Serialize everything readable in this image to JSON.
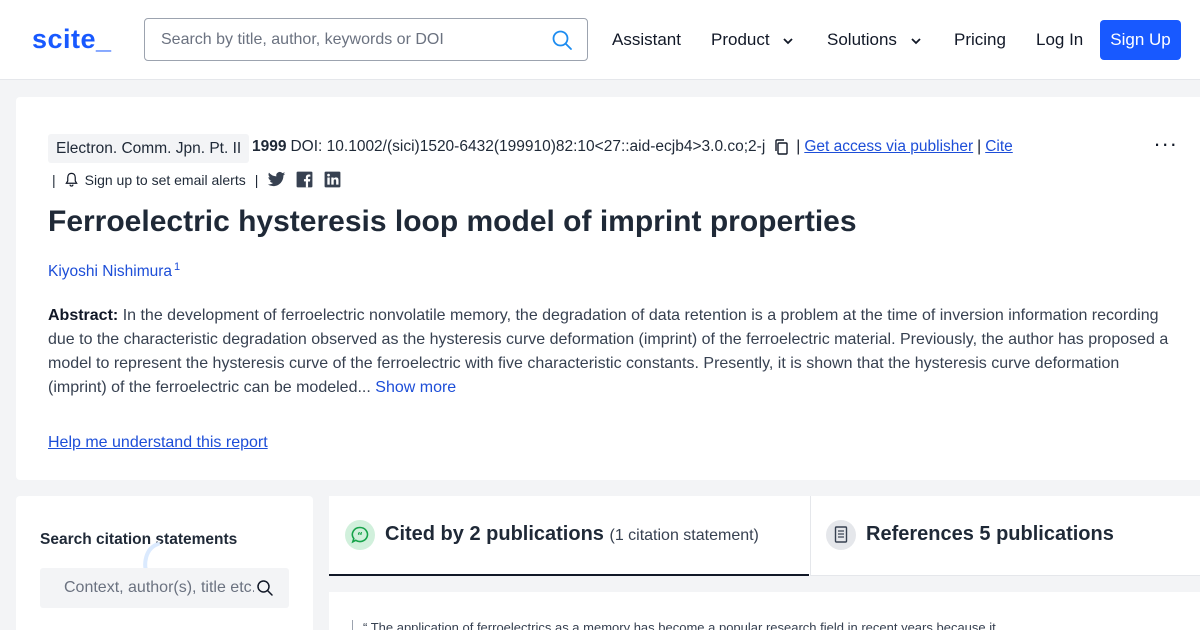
{
  "header": {
    "logo": "scite_",
    "search_placeholder": "Search by title, author, keywords or DOI",
    "nav": {
      "assistant": "Assistant",
      "product": "Product",
      "solutions": "Solutions",
      "pricing": "Pricing",
      "login": "Log In",
      "signup": "Sign Up"
    }
  },
  "paper": {
    "journal": "Electron. Comm. Jpn. Pt. II",
    "year": "1999",
    "doi": "DOI: 10.1002/(sici)1520-6432(199910)82:10<27::aid-ecjb4>3.0.co;2-j",
    "separator": "|",
    "get_access": "Get access via publisher",
    "cite": "Cite",
    "email_alerts": "Sign up to set email alerts",
    "more_menu": "...",
    "title": "Ferroelectric hysteresis loop model of imprint properties",
    "author": "Kiyoshi Nishimura",
    "author_affiliation_mark": "1",
    "abstract_label": "Abstract:",
    "abstract_text": "In the development of ferroelectric nonvolatile memory, the degradation of data retention is a problem at the time of inversion information recording due to the characteristic degradation observed as the hysteresis curve deformation (imprint) of the ferroelectric material. Previously, the author has proposed a model to represent the hysteresis curve of the ferroelectric with five characteristic constants. Presently, it is shown that the hysteresis curve deformation (imprint) of the ferroelectric can be modeled...",
    "show_more": "Show more",
    "help_link": "Help me understand this report"
  },
  "sidebar": {
    "title": "Search citation statements",
    "search_placeholder": "Context, author(s), title etc."
  },
  "tabs": {
    "cited_label": "Cited by 2 publications",
    "cited_sub": "(1 citation statement)",
    "refs_label": "References 5 publications"
  },
  "statement": {
    "quote": "“ The application of ferroelectrics as a memory has become a popular research field in recent years because it"
  },
  "colors": {
    "brand": "#1859ff",
    "link": "#1d4ed8",
    "background": "#f3f4f6"
  },
  "icons": [
    "search-icon",
    "chevron-down-icon",
    "copy-icon",
    "bell-icon",
    "twitter-icon",
    "facebook-icon",
    "linkedin-icon",
    "more-icon",
    "quote-bubble-icon",
    "document-icon"
  ]
}
